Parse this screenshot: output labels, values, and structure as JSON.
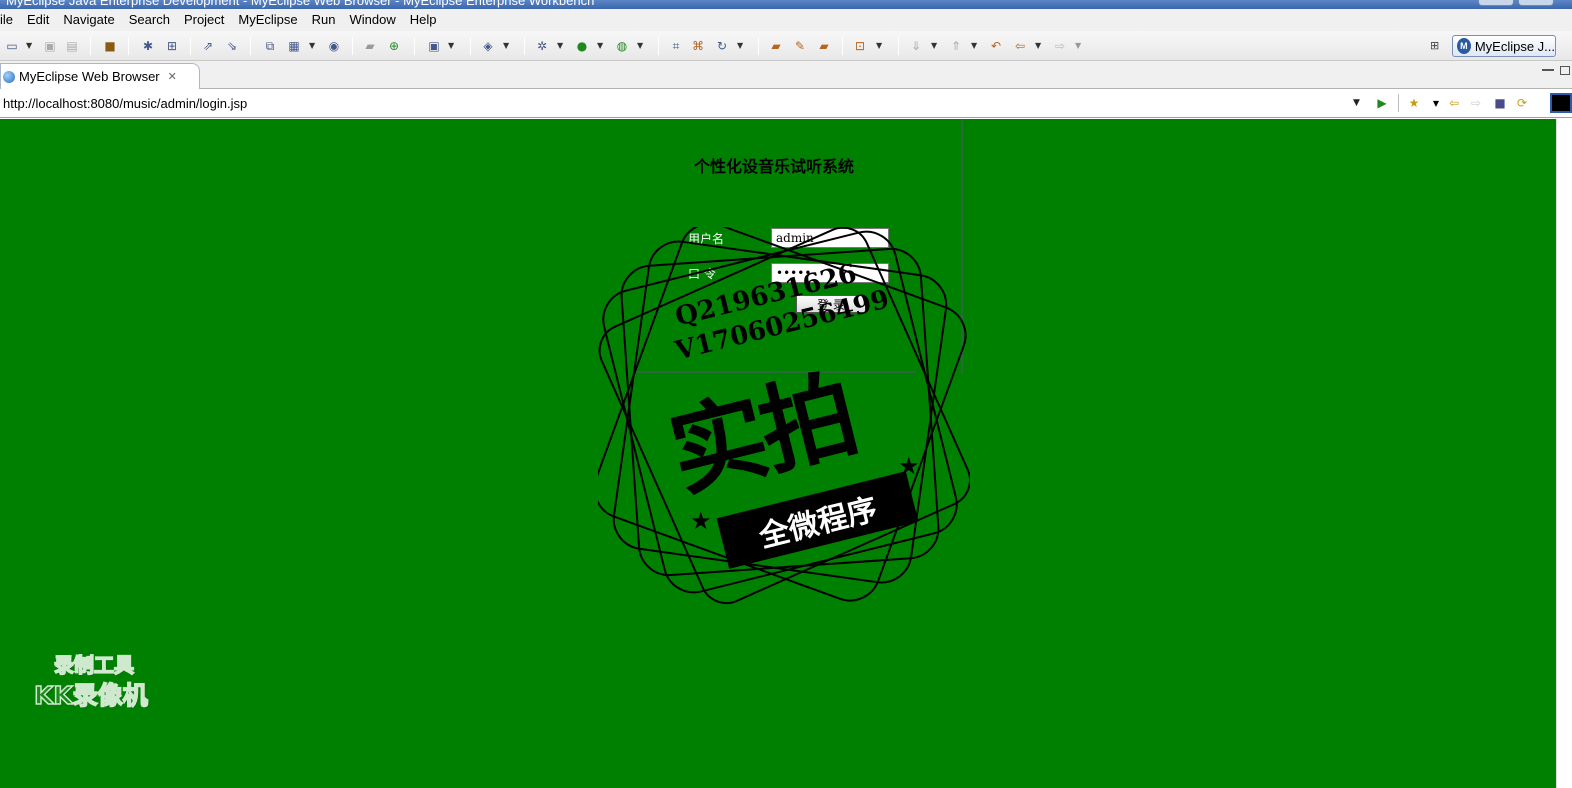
{
  "window": {
    "title": "MyEclipse Java Enterprise Development - MyEclipse Web Browser - MyEclipse Enterprise Workbench"
  },
  "menubar": {
    "items": [
      "ile",
      "Edit",
      "Navigate",
      "Search",
      "Project",
      "MyEclipse",
      "Run",
      "Window",
      "Help"
    ]
  },
  "toolbar": {
    "perspective_label": "MyEclipse J...",
    "perspective_logo": "M"
  },
  "editor": {
    "tab_label": "MyEclipse Web Browser",
    "tab_close": "✕"
  },
  "browser": {
    "url": "http://localhost:8080/music/admin/login.jsp"
  },
  "page": {
    "title": "个性化设音乐试听系统",
    "username_label": "用户名",
    "password_label": "口 令",
    "username_value": "admin",
    "password_value": "admin",
    "login_button": "登 录",
    "background_color": "#008000"
  },
  "watermark": {
    "qq": "Q219631626",
    "vx": "V17060256499",
    "main_text": "实拍",
    "banner_text": "全微程序"
  },
  "recorder": {
    "line1": "录制工具",
    "line2": "KK录像机"
  }
}
